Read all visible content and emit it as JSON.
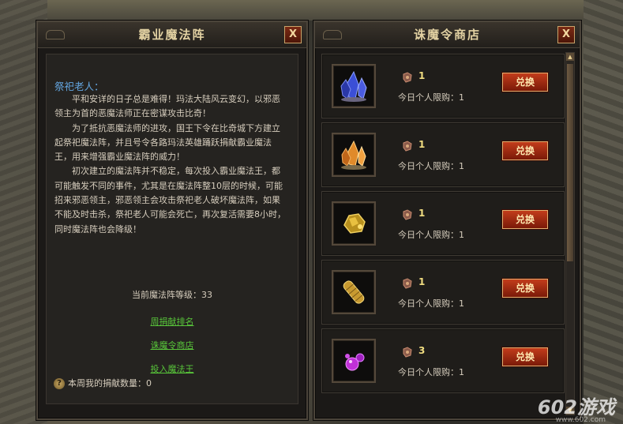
{
  "left_panel": {
    "title": "霸业魔法阵",
    "close_label": "X",
    "speaker": "祭祀老人：",
    "story": [
      "平和安详的日子总是难得！玛法大陆风云变幻，以邪恶领主为首的恶魔法师正在密谋攻击比奇！",
      "为了抵抗恶魔法师的进攻，国王下令在比奇城下方建立起祭祀魔法阵，并且号令各路玛法英雄踊跃捐献霸业魔法王，用来增强霸业魔法阵的威力！",
      "初次建立的魔法阵并不稳定，每次投入霸业魔法王，都可能触发不同的事件，尤其是在魔法阵整10层的时候，可能招来邪恶领主，邪恶领主会攻击祭祀老人破坏魔法阵，如果不能及时击杀，祭祀老人可能会死亡，再次复活需要8小时，同时魔法阵也会降级！"
    ],
    "level_label": "当前魔法阵等级：",
    "level_value": "33",
    "links": {
      "ranking": "周捐献排名",
      "shop": "诛魔令商店",
      "donate": "投入魔法王"
    },
    "footer_label": "本周我的捐献数量：",
    "footer_value": "0",
    "help_icon": "?"
  },
  "right_panel": {
    "title": "诛魔令商店",
    "close_label": "X",
    "items": [
      {
        "icon": "blue-crystal-icon",
        "count": "1",
        "limit_label": "今日个人限购：",
        "limit_value": "1",
        "button": "兑换"
      },
      {
        "icon": "orange-crystal-icon",
        "count": "1",
        "limit_label": "今日个人限购：",
        "limit_value": "1",
        "button": "兑换"
      },
      {
        "icon": "gold-ore-icon",
        "count": "1",
        "limit_label": "今日个人限购：",
        "limit_value": "1",
        "button": "兑换"
      },
      {
        "icon": "gold-scroll-icon",
        "count": "1",
        "limit_label": "今日个人限购：",
        "limit_value": "1",
        "button": "兑换"
      },
      {
        "icon": "purple-gem-icon",
        "count": "3",
        "limit_label": "今日个人限购：",
        "limit_value": "1",
        "button": "兑换"
      }
    ]
  },
  "watermark": {
    "brand": "602游戏",
    "url": "www.602.com"
  },
  "colors": {
    "accent_button": "#c23c1b",
    "link": "#58c53a",
    "speaker": "#64a6e0",
    "count": "#f0dc80"
  }
}
